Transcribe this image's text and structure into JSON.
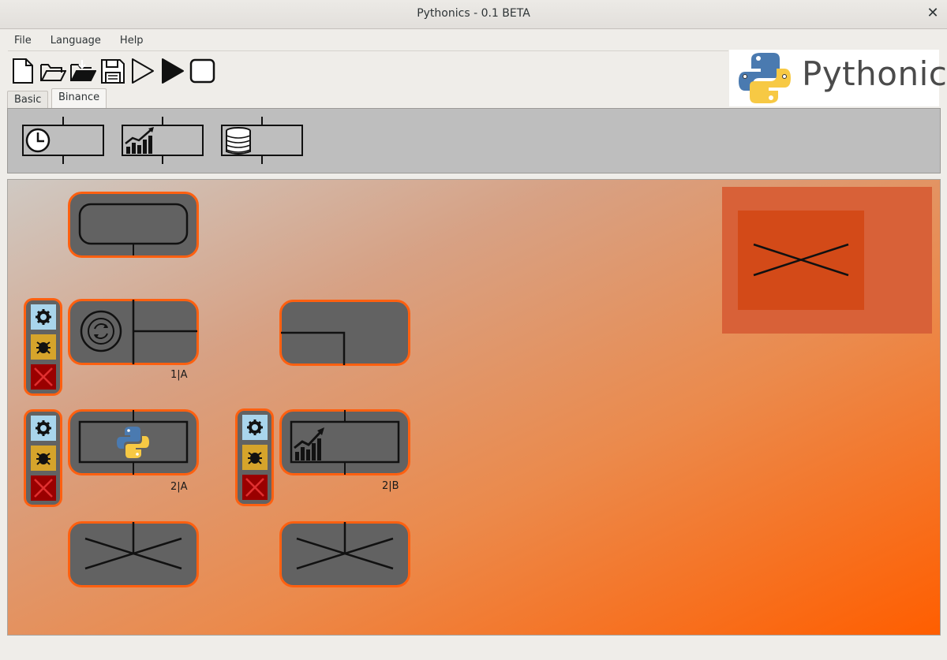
{
  "window": {
    "title": "Pythonics - 0.1 BETA",
    "close_glyph": "✕"
  },
  "menu": {
    "file": "File",
    "language": "Language",
    "help": "Help"
  },
  "toolbar": {
    "icons": [
      "new-file-icon",
      "open-folder-icon",
      "open-image-icon",
      "save-icon",
      "debug-play-icon",
      "play-icon",
      "stop-icon"
    ]
  },
  "logo": {
    "text": "Pythonic"
  },
  "tabs": {
    "basic": "Basic",
    "binance": "Binance",
    "active": "Binance"
  },
  "palette": {
    "items": [
      "scheduler-element",
      "ohlc-element",
      "account-element"
    ]
  },
  "canvas": {
    "grid_labels": {
      "e1": "1|A",
      "e2a": "2|A",
      "e2b": "2|B"
    }
  },
  "colors": {
    "element_bg": "#626262",
    "element_border": "#ff6010",
    "config_btn": "#a9d5ec",
    "debug_btn": "#d6a42b",
    "delete_btn": "#9a0000",
    "trash_area": "#d86138",
    "trash_inner": "#d34a18"
  }
}
